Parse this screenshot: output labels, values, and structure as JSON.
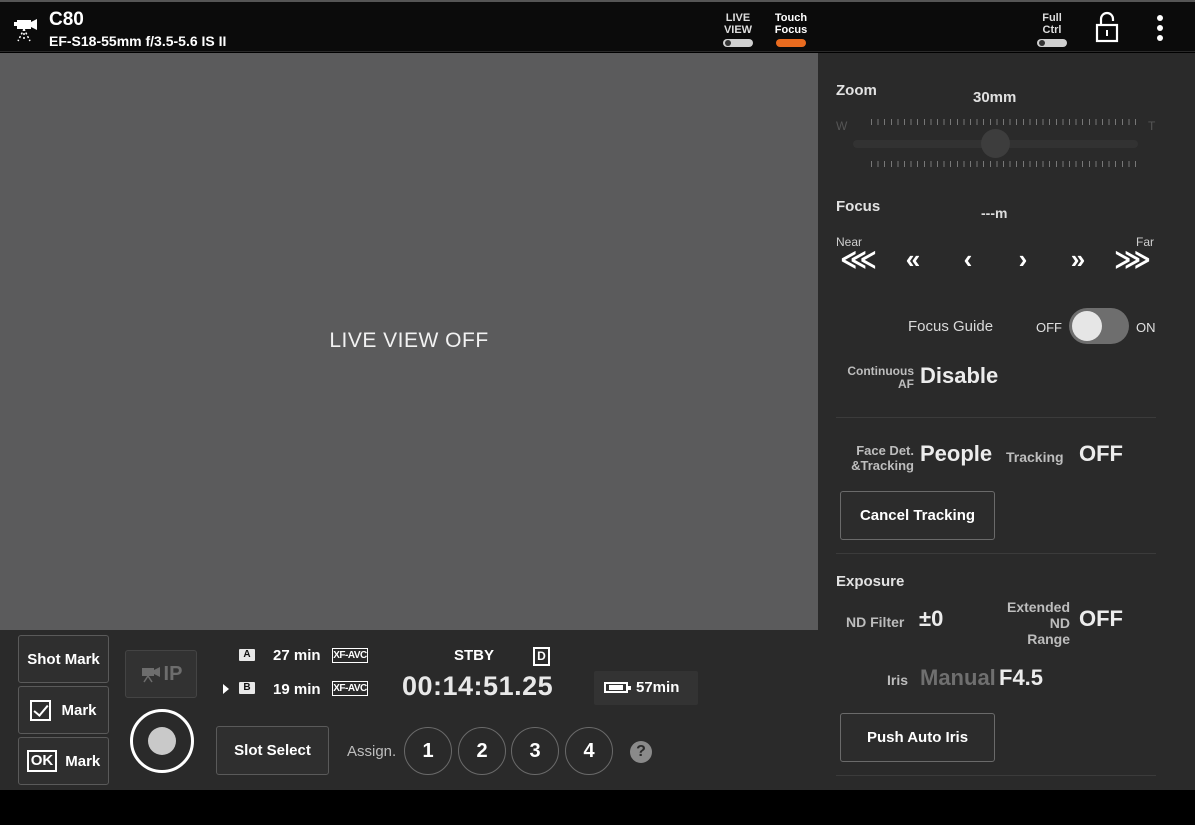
{
  "header": {
    "camera_model": "C80",
    "lens": "EF-S18-55mm f/3.5-5.6 IS II",
    "live_view_toggle": "LIVE\nVIEW",
    "live_view_label_line1": "LIVE",
    "live_view_label_line2": "VIEW",
    "touch_focus_line1": "Touch",
    "touch_focus_line2": "Focus",
    "full_ctrl_line1": "Full",
    "full_ctrl_line2": "Ctrl",
    "accent_color": "#e96b1f"
  },
  "liveview": {
    "message": "LIVE VIEW OFF"
  },
  "bottom": {
    "shot_mark": "Shot Mark",
    "mark_check": "Mark",
    "mark_ok": "Mark",
    "ok_text": "OK",
    "ip_logo": "IP",
    "slot_a": {
      "badge": "A",
      "time": "27 min",
      "format": "XF-AVC"
    },
    "slot_b": {
      "badge": "B",
      "time": "19 min",
      "format": "XF-AVC"
    },
    "status": "STBY",
    "d_icon": "D",
    "timecode": "00:14:51.25",
    "battery": "57min",
    "slot_select": "Slot Select",
    "assign_label": "Assign.",
    "assign_buttons": [
      "1",
      "2",
      "3",
      "4"
    ],
    "help": "?"
  },
  "panel": {
    "zoom": {
      "title": "Zoom",
      "value": "30mm",
      "wide": "W",
      "tele": "T"
    },
    "focus": {
      "title": "Focus",
      "value": "---m",
      "near": "Near",
      "far": "Far",
      "arrows": [
        "⋘",
        "«",
        "‹",
        "›",
        "»",
        "⋙"
      ]
    },
    "focus_guide": {
      "label": "Focus Guide",
      "off": "OFF",
      "on": "ON",
      "state": "off"
    },
    "continuous_af": {
      "label_line1": "Continuous",
      "label_line2": "AF",
      "value": "Disable"
    },
    "face_det": {
      "label_line1": "Face Det.",
      "label_line2": "&Tracking",
      "value": "People"
    },
    "tracking": {
      "label": "Tracking",
      "value": "OFF"
    },
    "cancel_tracking": "Cancel Tracking",
    "exposure": {
      "title": "Exposure",
      "nd_label": "ND Filter",
      "nd_value": "±0",
      "ext_nd_line1": "Extended",
      "ext_nd_line2": "ND",
      "ext_nd_line3": "Range",
      "ext_nd_value": "OFF",
      "iris_label": "Iris",
      "iris_mode": "Manual",
      "iris_value": "F4.5"
    },
    "push_auto_iris": "Push Auto Iris"
  }
}
